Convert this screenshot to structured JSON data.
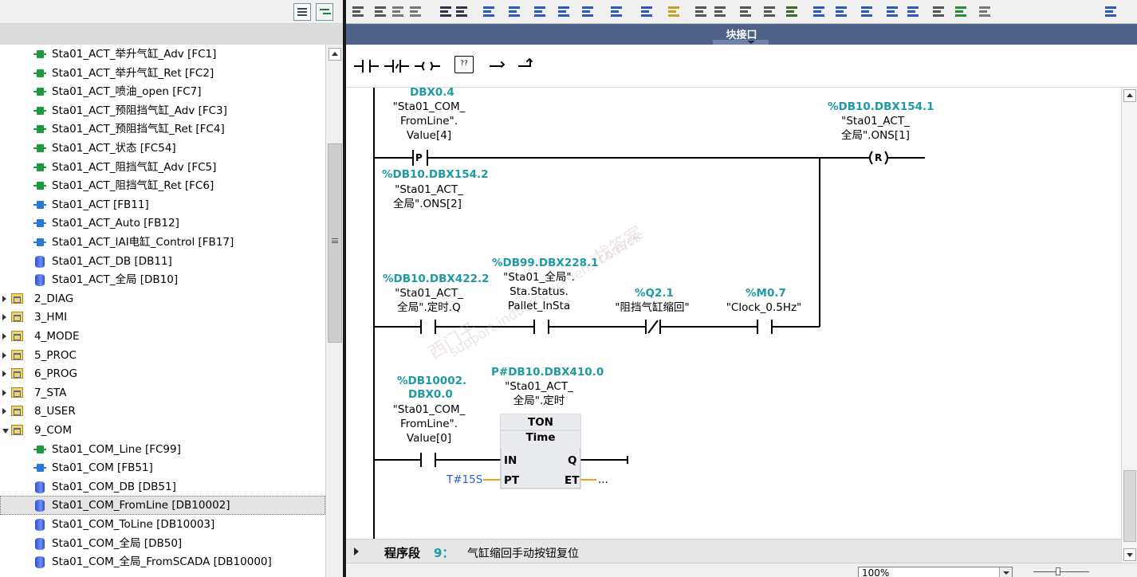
{
  "project_tree": {
    "items": [
      {
        "label": "Sta01_ACT_举升气缸_Adv [FC1]",
        "type": "fc",
        "level": 2
      },
      {
        "label": "Sta01_ACT_举升气缸_Ret [FC2]",
        "type": "fc",
        "level": 2
      },
      {
        "label": "Sta01_ACT_喷油_open [FC7]",
        "type": "fc",
        "level": 2
      },
      {
        "label": "Sta01_ACT_预阻挡气缸_Adv [FC3]",
        "type": "fc",
        "level": 2
      },
      {
        "label": "Sta01_ACT_预阻挡气缸_Ret [FC4]",
        "type": "fc",
        "level": 2
      },
      {
        "label": "Sta01_ACT_状态 [FC54]",
        "type": "fc",
        "level": 2
      },
      {
        "label": "Sta01_ACT_阻挡气缸_Adv [FC5]",
        "type": "fc",
        "level": 2
      },
      {
        "label": "Sta01_ACT_阻挡气缸_Ret [FC6]",
        "type": "fc",
        "level": 2
      },
      {
        "label": "Sta01_ACT [FB11]",
        "type": "fb",
        "level": 2
      },
      {
        "label": "Sta01_ACT_Auto [FB12]",
        "type": "fb",
        "level": 2
      },
      {
        "label": "Sta01_ACT_IAI电缸_Control [FB17]",
        "type": "fb",
        "level": 2
      },
      {
        "label": "Sta01_ACT_DB [DB11]",
        "type": "db",
        "level": 2
      },
      {
        "label": "Sta01_ACT_全局 [DB10]",
        "type": "db",
        "level": 2
      },
      {
        "label": "2_DIAG",
        "type": "folder",
        "level": 1,
        "expanded": false
      },
      {
        "label": "3_HMI",
        "type": "folder",
        "level": 1,
        "expanded": false
      },
      {
        "label": "4_MODE",
        "type": "folder",
        "level": 1,
        "expanded": false
      },
      {
        "label": "5_PROC",
        "type": "folder",
        "level": 1,
        "expanded": false
      },
      {
        "label": "6_PROG",
        "type": "folder",
        "level": 1,
        "expanded": false
      },
      {
        "label": "7_STA",
        "type": "folder",
        "level": 1,
        "expanded": false
      },
      {
        "label": "8_USER",
        "type": "folder",
        "level": 1,
        "expanded": false
      },
      {
        "label": "9_COM",
        "type": "folder",
        "level": 1,
        "expanded": true
      },
      {
        "label": "Sta01_COM_Line [FC99]",
        "type": "fc",
        "level": 2
      },
      {
        "label": "Sta01_COM [FB51]",
        "type": "fb",
        "level": 2
      },
      {
        "label": "Sta01_COM_DB [DB51]",
        "type": "db",
        "level": 2
      },
      {
        "label": "Sta01_COM_FromLine [DB10002]",
        "type": "db",
        "level": 2,
        "selected": true
      },
      {
        "label": "Sta01_COM_ToLine [DB10003]",
        "type": "db",
        "level": 2
      },
      {
        "label": "Sta01_COM_全局 [DB50]",
        "type": "db",
        "level": 2
      },
      {
        "label": "Sta01_COM_全局_FromSCADA [DB10000]",
        "type": "db",
        "level": 2
      }
    ]
  },
  "editor": {
    "block_interface_label": "块接口",
    "rung1": {
      "contact_address_tail": "DBX0.4",
      "contact_symbol": [
        "\"Sta01_COM_",
        "FromLine\".",
        "Value[4]"
      ],
      "contact_type": "P",
      "edge_address": "%DB10.DBX154.2",
      "edge_symbol": [
        "\"Sta01_ACT_",
        "全局\".ONS[2]"
      ],
      "coil_address": "%DB10.DBX154.1",
      "coil_symbol": [
        "\"Sta01_ACT_",
        "全局\".ONS[1]"
      ],
      "coil_type": "R"
    },
    "rung2": {
      "c1_address": "%DB10.DBX422.2",
      "c1_symbol": [
        "\"Sta01_ACT_",
        "全局\".定时.Q"
      ],
      "c2_address": "%DB99.DBX228.1",
      "c2_symbol": [
        "\"Sta01_全局\".",
        "Sta.Status.",
        "Pallet_InSta"
      ],
      "c3_address": "%Q2.1",
      "c3_symbol": "\"阻挡气缸缩回\"",
      "c4_address": "%M0.7",
      "c4_symbol": "\"Clock_0.5Hz\""
    },
    "rung3": {
      "contact_address": [
        "%DB10002.",
        "DBX0.0"
      ],
      "contact_symbol": [
        "\"Sta01_COM_",
        "FromLine\".",
        "Value[0]"
      ],
      "timer_instance_address": "P#DB10.DBX410.0",
      "timer_instance_symbol": [
        "\"Sta01_ACT_",
        "全局\".定时"
      ],
      "timer_type": "TON",
      "timer_subtype": "Time",
      "pin_in": "IN",
      "pin_pt": "PT",
      "pin_q": "Q",
      "pin_et": "ET",
      "pt_value": "T#15S",
      "et_value": "..."
    },
    "network": {
      "title": "程序段",
      "number": "9：",
      "comment": "气缸缩回手动按钮复位"
    },
    "zoom_level": "100%"
  },
  "watermark": [
    "找答案",
    "support.industry.siemens.com/cs",
    "西门子"
  ],
  "colors": {
    "address": "#1d9aa4",
    "interface_bar": "#4d6286",
    "fc_icon": "#1e9a3c",
    "fb_icon": "#2a78d6",
    "db_icon": "#2e4fd0"
  }
}
